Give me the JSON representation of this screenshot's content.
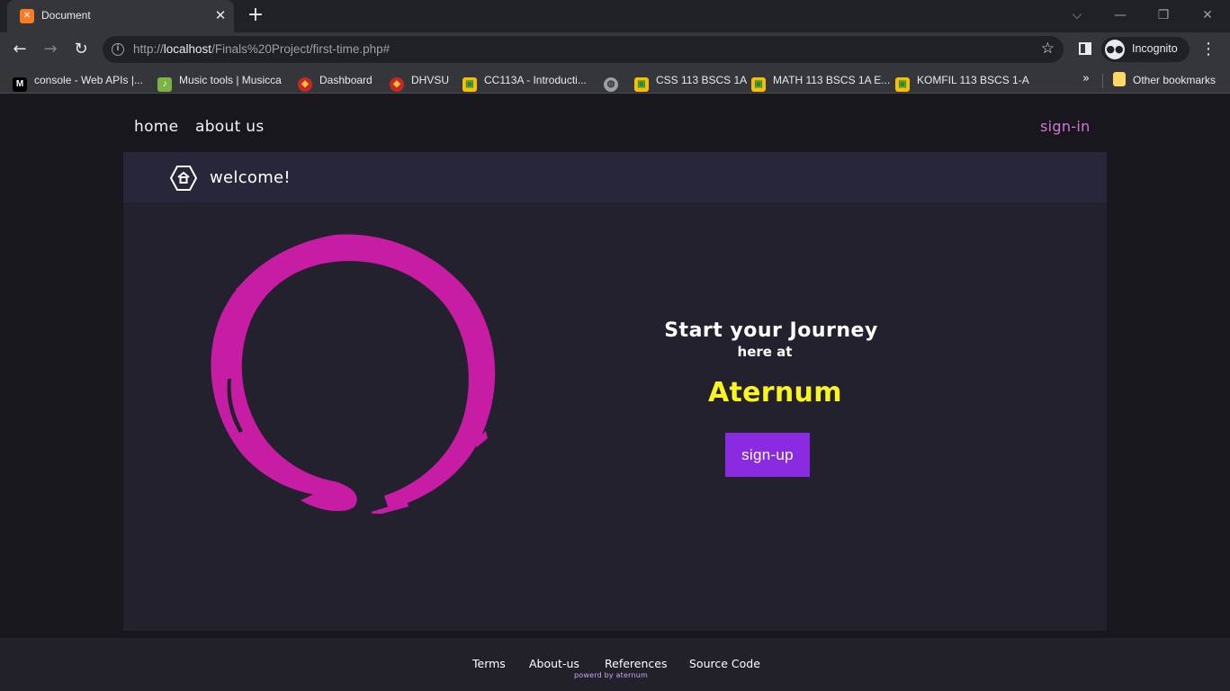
{
  "browser": {
    "tab_title": "Document",
    "url_prefix": "http://",
    "url_host": "localhost",
    "url_path": "/Finals%20Project/first-time.php#",
    "profile_label": "Incognito",
    "bookmarks": [
      {
        "label": "console - Web APIs |...",
        "icon": "mdn-icon",
        "color": "#000000"
      },
      {
        "label": "Music tools | Musicca",
        "icon": "music-note-icon",
        "color": "#7cb342"
      },
      {
        "label": "Dashboard",
        "icon": "shield-logo-icon",
        "color": "#c62828"
      },
      {
        "label": "DHVSU",
        "icon": "shield-logo-icon",
        "color": "#c62828"
      },
      {
        "label": "CC113A - Introducti...",
        "icon": "classroom-icon",
        "color": "#fbbc04"
      },
      {
        "label": "",
        "icon": "globe-icon",
        "color": "#9aa0a6"
      },
      {
        "label": "CSS 113 BSCS 1A",
        "icon": "classroom-icon",
        "color": "#fbbc04"
      },
      {
        "label": "MATH 113 BSCS 1A E...",
        "icon": "classroom-icon",
        "color": "#fbbc04"
      },
      {
        "label": "KOMFIL 113 BSCS 1-A",
        "icon": "classroom-icon",
        "color": "#fbbc04"
      }
    ],
    "overflow_label": "»",
    "other_bookmarks": "Other bookmarks"
  },
  "nav": {
    "home": "home",
    "about": "about us",
    "signin": "sign-in"
  },
  "card": {
    "welcome": "welcome!",
    "cta_title": "Start your Journey",
    "cta_sub": "here at",
    "brand": "Aternum",
    "signup": "sign-up"
  },
  "footer": {
    "links": [
      "Terms",
      "About-us",
      "References",
      "Source Code"
    ],
    "powered": "powerd by aternum"
  },
  "colors": {
    "accent_button": "#8a2be2",
    "brand_yellow": "#faf420",
    "enso_magenta": "#c71ca4",
    "signin_pink": "#d277d4"
  }
}
